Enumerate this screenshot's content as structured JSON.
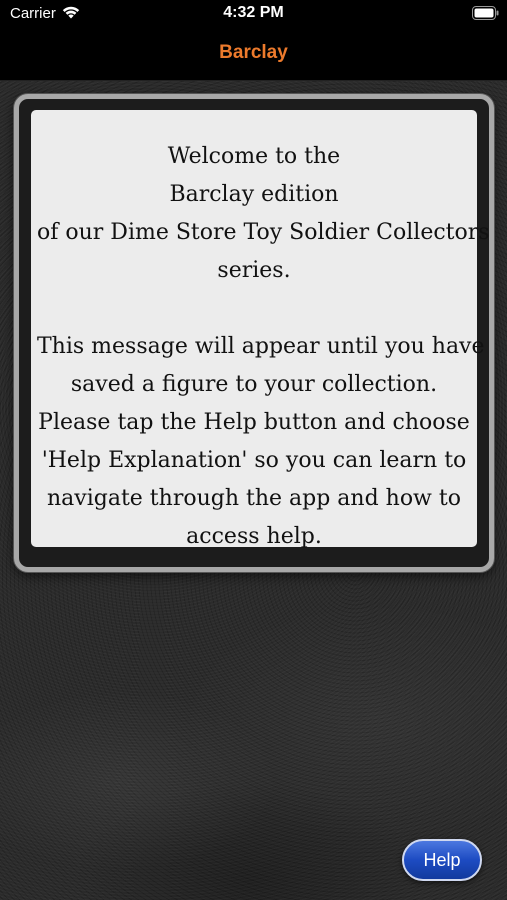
{
  "status_bar": {
    "carrier": "Carrier",
    "time": "4:32 PM",
    "wifi_icon": "wifi-icon",
    "battery_icon": "battery-icon"
  },
  "nav": {
    "title": "Barclay",
    "title_color": "#ec7a2c"
  },
  "message": {
    "lines": [
      "Welcome to the",
      "Barclay edition",
      "of our Dime Store Toy Soldier Collectors",
      "series.",
      "",
      "This message will appear until you have",
      "saved a figure to your collection.",
      "Please tap the Help button and choose",
      "'Help Explanation' so you can learn to",
      "navigate through the app and how to",
      "access help."
    ]
  },
  "help_button": {
    "label": "Help",
    "color": "#1d4bc2"
  }
}
